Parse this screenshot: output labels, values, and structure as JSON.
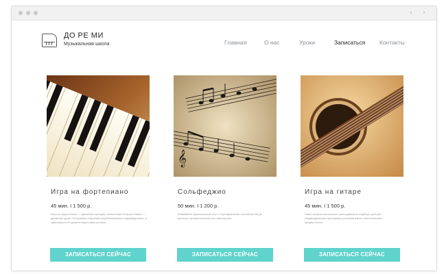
{
  "brand": {
    "title": "ДО РЕ МИ",
    "subtitle": "Музыкальная школа"
  },
  "nav": [
    {
      "label": "Главная",
      "active": false
    },
    {
      "label": "О нас",
      "active": false
    },
    {
      "label": "Уроки",
      "active": false
    },
    {
      "label": "Записаться",
      "active": true
    },
    {
      "label": "Контакты",
      "active": false
    }
  ],
  "cards": [
    {
      "title": "Игра на фортепиано",
      "price": "45 мин. I 1 500 р.",
      "description": "Игра на фортепиано — движение пальцев, исполнение на фортепиано — движение души. Программы обучения разрабатываются индивидуально, в зависимости от уровня подготовки ученика.",
      "button": "ЗАПИСАТЬСЯ СЕЙЧАС",
      "image": "piano-keys"
    },
    {
      "title": "Сольфеджио",
      "price": "50 мин. I 1 200 р.",
      "description": "Развивайте музыкальный слух с сертификатами способностей до высокого профессионального мастерства.",
      "button": "ЗАПИСАТЬСЯ СЕЙЧАС",
      "image": "sheet-music"
    },
    {
      "title": "Игра на гитаре",
      "price": "45 мин. I 1 500 р.",
      "description": "Наши профессиональные преподаватели подберут для вас индивидуальную программу, учитывая ваши стилистические предпочтения.",
      "button": "ЗАПИСАТЬСЯ СЕЙЧАС",
      "image": "acoustic-guitar"
    }
  ],
  "colors": {
    "accent": "#5fd3cc",
    "nav": "#8a8f98",
    "text": "#444444"
  }
}
